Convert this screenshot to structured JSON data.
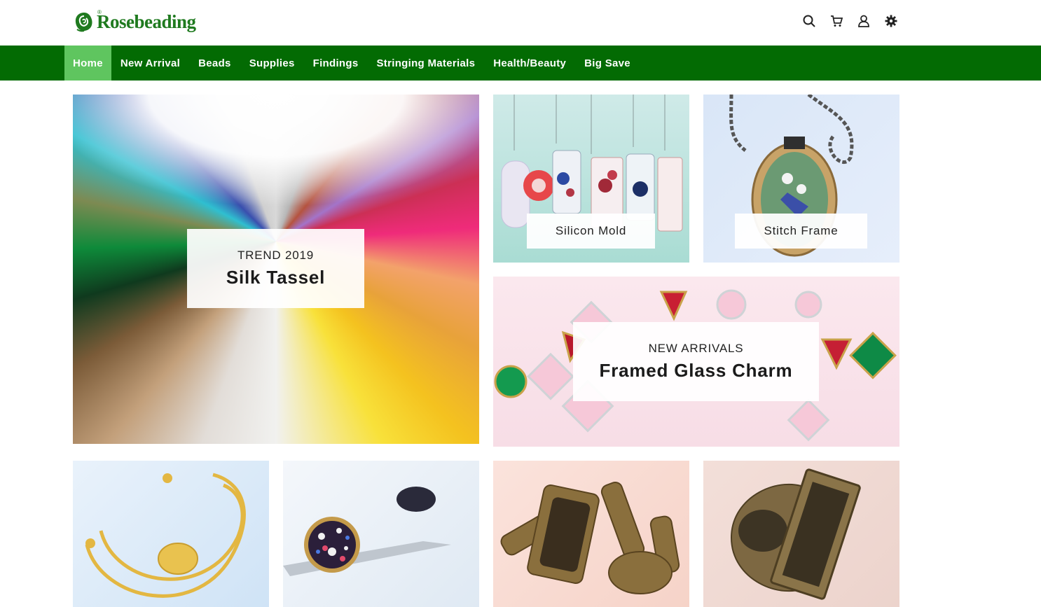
{
  "brand": {
    "name": "Rosebeading",
    "reg_mark": "®",
    "color": "#1f7a1f"
  },
  "header_icons": [
    "search-icon",
    "cart-icon",
    "user-icon",
    "settings-icon"
  ],
  "nav": {
    "bg_color": "#036b03",
    "active_color": "#5fc55f",
    "items": [
      {
        "label": "Home",
        "active": true
      },
      {
        "label": "New Arrival"
      },
      {
        "label": "Beads"
      },
      {
        "label": "Supplies"
      },
      {
        "label": "Findings"
      },
      {
        "label": "Stringing Materials"
      },
      {
        "label": "Health/Beauty"
      },
      {
        "label": "Big Save"
      }
    ]
  },
  "banners": {
    "tassel": {
      "subtitle": "TREND 2019",
      "title": "Silk Tassel"
    },
    "silicon": {
      "label": "Silicon Mold"
    },
    "stitch": {
      "label": "Stitch Frame"
    },
    "glass": {
      "subtitle": "NEW ARRIVALS",
      "title": "Framed Glass Charm"
    }
  },
  "bottom_tiles": [
    "bangle-image",
    "hair-clip-image",
    "cufflink-image",
    "ring-image"
  ]
}
